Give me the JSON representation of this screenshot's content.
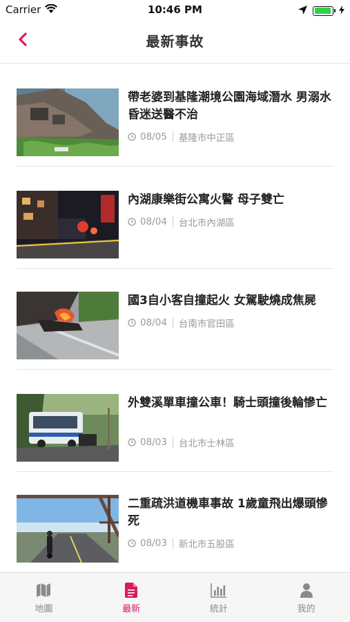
{
  "status_bar": {
    "carrier": "Carrier",
    "time": "10:46 PM",
    "battery_level": 0.95
  },
  "nav": {
    "title": "最新事故",
    "back_icon": "chevron-left-icon",
    "accent_color": "#d81b60"
  },
  "news": [
    {
      "headline": "帶老婆到基隆潮境公園海域潛水 男溺水昏迷送醫不治",
      "date": "08/05",
      "location": "基隆市中正區",
      "thumbnail": "coastal-rocks-photo"
    },
    {
      "headline": "內湖康樂街公寓火警 母子雙亡",
      "date": "08/04",
      "location": "台北市內湖區",
      "thumbnail": "night-fire-scene-photo"
    },
    {
      "headline": "國3自小客自撞起火 女駕駛燒成焦屍",
      "date": "08/04",
      "location": "台南市官田區",
      "thumbnail": "burning-car-highway-photo"
    },
    {
      "headline": "外雙溪單車撞公車！騎士頭撞後輪慘亡",
      "date": "08/03",
      "location": "台北市士林區",
      "thumbnail": "bus-accident-photo"
    },
    {
      "headline": "二重疏洪道機車事故 1歲童飛出爆頭慘死",
      "date": "08/03",
      "location": "新北市五股區",
      "thumbnail": "bridge-motorcycle-photo"
    }
  ],
  "tabs": [
    {
      "label": "地圖",
      "icon": "map-icon",
      "active": false
    },
    {
      "label": "最新",
      "icon": "document-icon",
      "active": true
    },
    {
      "label": "統計",
      "icon": "bar-chart-icon",
      "active": false
    },
    {
      "label": "我的",
      "icon": "person-icon",
      "active": false
    }
  ]
}
